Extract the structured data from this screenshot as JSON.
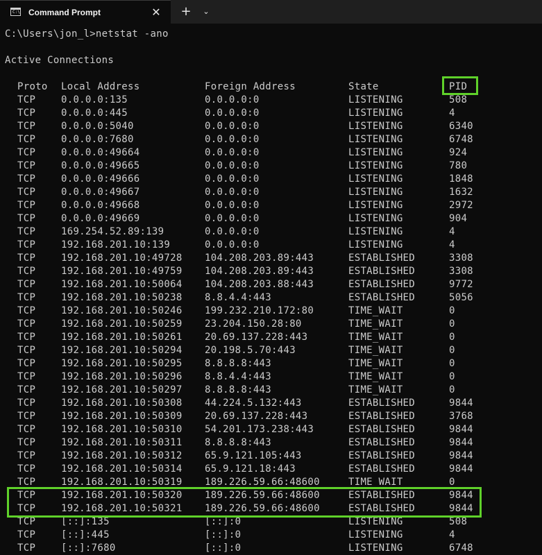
{
  "window": {
    "tab_title": "Command Prompt",
    "tab_icon": "terminal-icon",
    "close_glyph": "✕",
    "new_tab_glyph": "+",
    "dropdown_glyph": "⌄"
  },
  "terminal": {
    "command_line": "C:\\Users\\jon_l>netstat -ano",
    "section_title": "Active Connections",
    "headers": {
      "proto": "Proto",
      "local": "Local Address",
      "foreign": "Foreign Address",
      "state": "State",
      "pid": "PID"
    },
    "rows": [
      {
        "proto": "TCP",
        "local": "0.0.0.0:135",
        "foreign": "0.0.0.0:0",
        "state": "LISTENING",
        "pid": "508"
      },
      {
        "proto": "TCP",
        "local": "0.0.0.0:445",
        "foreign": "0.0.0.0:0",
        "state": "LISTENING",
        "pid": "4"
      },
      {
        "proto": "TCP",
        "local": "0.0.0.0:5040",
        "foreign": "0.0.0.0:0",
        "state": "LISTENING",
        "pid": "6340"
      },
      {
        "proto": "TCP",
        "local": "0.0.0.0:7680",
        "foreign": "0.0.0.0:0",
        "state": "LISTENING",
        "pid": "6748"
      },
      {
        "proto": "TCP",
        "local": "0.0.0.0:49664",
        "foreign": "0.0.0.0:0",
        "state": "LISTENING",
        "pid": "924"
      },
      {
        "proto": "TCP",
        "local": "0.0.0.0:49665",
        "foreign": "0.0.0.0:0",
        "state": "LISTENING",
        "pid": "780"
      },
      {
        "proto": "TCP",
        "local": "0.0.0.0:49666",
        "foreign": "0.0.0.0:0",
        "state": "LISTENING",
        "pid": "1848"
      },
      {
        "proto": "TCP",
        "local": "0.0.0.0:49667",
        "foreign": "0.0.0.0:0",
        "state": "LISTENING",
        "pid": "1632"
      },
      {
        "proto": "TCP",
        "local": "0.0.0.0:49668",
        "foreign": "0.0.0.0:0",
        "state": "LISTENING",
        "pid": "2972"
      },
      {
        "proto": "TCP",
        "local": "0.0.0.0:49669",
        "foreign": "0.0.0.0:0",
        "state": "LISTENING",
        "pid": "904"
      },
      {
        "proto": "TCP",
        "local": "169.254.52.89:139",
        "foreign": "0.0.0.0:0",
        "state": "LISTENING",
        "pid": "4"
      },
      {
        "proto": "TCP",
        "local": "192.168.201.10:139",
        "foreign": "0.0.0.0:0",
        "state": "LISTENING",
        "pid": "4"
      },
      {
        "proto": "TCP",
        "local": "192.168.201.10:49728",
        "foreign": "104.208.203.89:443",
        "state": "ESTABLISHED",
        "pid": "3308"
      },
      {
        "proto": "TCP",
        "local": "192.168.201.10:49759",
        "foreign": "104.208.203.89:443",
        "state": "ESTABLISHED",
        "pid": "3308"
      },
      {
        "proto": "TCP",
        "local": "192.168.201.10:50064",
        "foreign": "104.208.203.88:443",
        "state": "ESTABLISHED",
        "pid": "9772"
      },
      {
        "proto": "TCP",
        "local": "192.168.201.10:50238",
        "foreign": "8.8.4.4:443",
        "state": "ESTABLISHED",
        "pid": "5056"
      },
      {
        "proto": "TCP",
        "local": "192.168.201.10:50246",
        "foreign": "199.232.210.172:80",
        "state": "TIME_WAIT",
        "pid": "0"
      },
      {
        "proto": "TCP",
        "local": "192.168.201.10:50259",
        "foreign": "23.204.150.28:80",
        "state": "TIME_WAIT",
        "pid": "0"
      },
      {
        "proto": "TCP",
        "local": "192.168.201.10:50261",
        "foreign": "20.69.137.228:443",
        "state": "TIME_WAIT",
        "pid": "0"
      },
      {
        "proto": "TCP",
        "local": "192.168.201.10:50294",
        "foreign": "20.198.5.70:443",
        "state": "TIME_WAIT",
        "pid": "0"
      },
      {
        "proto": "TCP",
        "local": "192.168.201.10:50295",
        "foreign": "8.8.8.8:443",
        "state": "TIME_WAIT",
        "pid": "0"
      },
      {
        "proto": "TCP",
        "local": "192.168.201.10:50296",
        "foreign": "8.8.4.4:443",
        "state": "TIME_WAIT",
        "pid": "0"
      },
      {
        "proto": "TCP",
        "local": "192.168.201.10:50297",
        "foreign": "8.8.8.8:443",
        "state": "TIME_WAIT",
        "pid": "0"
      },
      {
        "proto": "TCP",
        "local": "192.168.201.10:50308",
        "foreign": "44.224.5.132:443",
        "state": "ESTABLISHED",
        "pid": "9844"
      },
      {
        "proto": "TCP",
        "local": "192.168.201.10:50309",
        "foreign": "20.69.137.228:443",
        "state": "ESTABLISHED",
        "pid": "3768"
      },
      {
        "proto": "TCP",
        "local": "192.168.201.10:50310",
        "foreign": "54.201.173.238:443",
        "state": "ESTABLISHED",
        "pid": "9844"
      },
      {
        "proto": "TCP",
        "local": "192.168.201.10:50311",
        "foreign": "8.8.8.8:443",
        "state": "ESTABLISHED",
        "pid": "9844"
      },
      {
        "proto": "TCP",
        "local": "192.168.201.10:50312",
        "foreign": "65.9.121.105:443",
        "state": "ESTABLISHED",
        "pid": "9844"
      },
      {
        "proto": "TCP",
        "local": "192.168.201.10:50314",
        "foreign": "65.9.121.18:443",
        "state": "ESTABLISHED",
        "pid": "9844"
      },
      {
        "proto": "TCP",
        "local": "192.168.201.10:50319",
        "foreign": "189.226.59.66:48600",
        "state": "TIME_WAIT",
        "pid": "0"
      },
      {
        "proto": "TCP",
        "local": "192.168.201.10:50320",
        "foreign": "189.226.59.66:48600",
        "state": "ESTABLISHED",
        "pid": "9844"
      },
      {
        "proto": "TCP",
        "local": "192.168.201.10:50321",
        "foreign": "189.226.59.66:48600",
        "state": "ESTABLISHED",
        "pid": "9844"
      },
      {
        "proto": "TCP",
        "local": "[::]:135",
        "foreign": "[::]:0",
        "state": "LISTENING",
        "pid": "508"
      },
      {
        "proto": "TCP",
        "local": "[::]:445",
        "foreign": "[::]:0",
        "state": "LISTENING",
        "pid": "4"
      },
      {
        "proto": "TCP",
        "local": "[::]:7680",
        "foreign": "[::]:0",
        "state": "LISTENING",
        "pid": "6748"
      }
    ]
  },
  "annotations": {
    "highlight_color": "#5fd12a"
  }
}
